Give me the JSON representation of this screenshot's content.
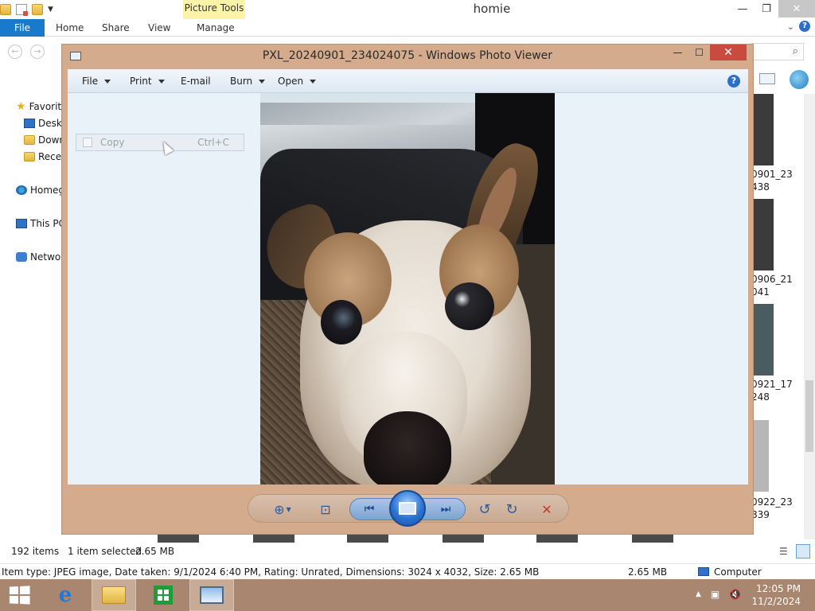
{
  "explorer": {
    "title": "homie",
    "contextual_tab_group": "Picture Tools",
    "ribbon_tabs": [
      "File",
      "Home",
      "Share",
      "View",
      "Manage"
    ],
    "nav_pane": [
      "Favorit",
      "Desk",
      "Dowr",
      "Rece",
      "Homeg",
      "This PC",
      "Netwo"
    ],
    "right_file_labels": [
      [
        "0901_23",
        "438"
      ],
      [
        "0906_21",
        "041"
      ],
      [
        "0921_17",
        "248"
      ],
      [
        "0922_23",
        "839"
      ]
    ],
    "status": {
      "items_count": "192 items",
      "selected": "1 item selected",
      "selected_size": "2.65 MB"
    },
    "details_bar": {
      "text": "Item type: JPEG image, Date taken: 9/1/2024 6:40 PM, Rating: Unrated, Dimensions: 3024 x 4032, Size: 2.65 MB",
      "size": "2.65 MB",
      "location": "Computer"
    }
  },
  "viewer": {
    "title": "PXL_20240901_234024075 - Windows Photo Viewer",
    "menu": {
      "file": "File",
      "print": "Print",
      "email": "E-mail",
      "burn": "Burn",
      "open": "Open"
    },
    "help_glyph": "?",
    "context_menu": {
      "copy_label": "Copy",
      "copy_shortcut": "Ctrl+C"
    },
    "controls": [
      {
        "name": "zoom-icon",
        "glyph": "⊕"
      },
      {
        "name": "actual-size-icon",
        "glyph": "⊡"
      },
      {
        "name": "previous-icon",
        "glyph": "⏮"
      },
      {
        "name": "slideshow-icon",
        "glyph": ""
      },
      {
        "name": "next-icon",
        "glyph": "⏭"
      },
      {
        "name": "rotate-counterclockwise-icon",
        "glyph": "↺"
      },
      {
        "name": "rotate-clockwise-icon",
        "glyph": "↻"
      },
      {
        "name": "delete-icon",
        "glyph": "✕"
      }
    ],
    "colors": {
      "frame": "#d4ab8d",
      "delete": "#c0392b",
      "nav": "#2d5e9c"
    }
  },
  "taskbar": {
    "time": "12:05 PM",
    "date": "11/2/2024",
    "pinned": [
      "internet-explorer-icon",
      "file-explorer-icon",
      "store-icon",
      "photo-viewer-icon"
    ]
  }
}
